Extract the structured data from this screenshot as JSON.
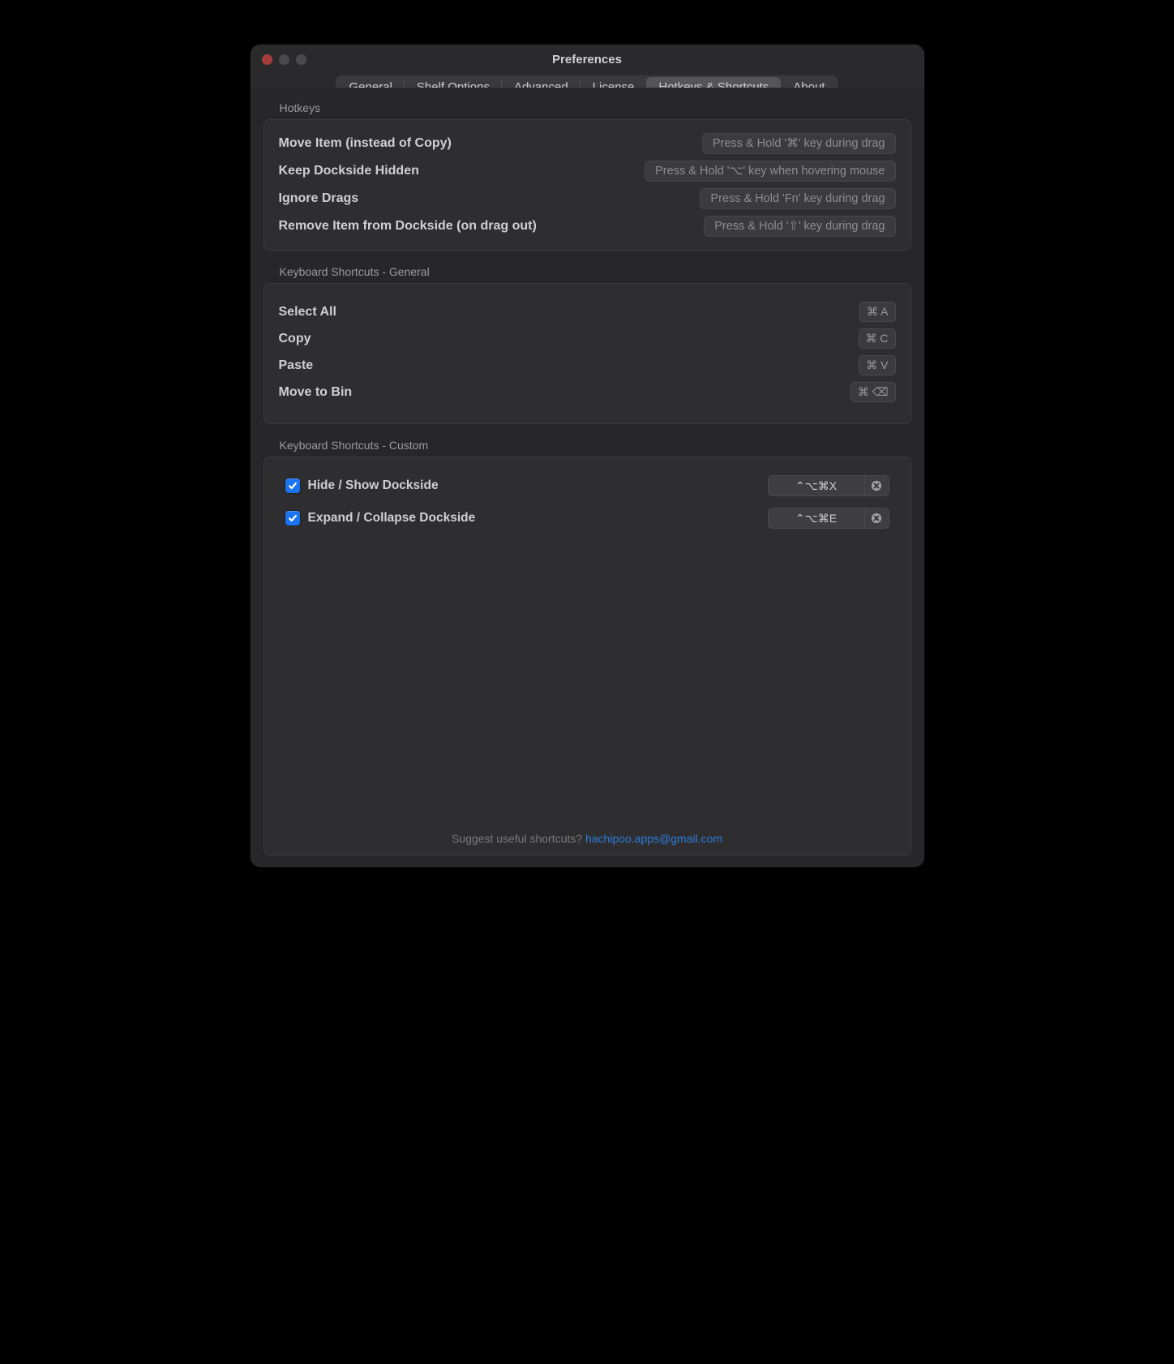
{
  "window": {
    "title": "Preferences"
  },
  "tabs": [
    {
      "label": "General",
      "selected": false
    },
    {
      "label": "Shelf Options",
      "selected": false
    },
    {
      "label": "Advanced",
      "selected": false
    },
    {
      "label": "License",
      "selected": false
    },
    {
      "label": "Hotkeys & Shortcuts",
      "selected": true
    },
    {
      "label": "About",
      "selected": false
    }
  ],
  "sections": {
    "hotkeys": {
      "title": "Hotkeys",
      "rows": [
        {
          "label": "Move Item (instead of Copy)",
          "hint": "Press & Hold '⌘' key during drag"
        },
        {
          "label": "Keep Dockside Hidden",
          "hint": "Press & Hold '⌥' key when hovering mouse"
        },
        {
          "label": "Ignore Drags",
          "hint": "Press & Hold 'Fn' key during drag"
        },
        {
          "label": "Remove Item from Dockside (on drag out)",
          "hint": "Press & Hold '⇧' key during drag"
        }
      ]
    },
    "general": {
      "title": "Keyboard Shortcuts - General",
      "rows": [
        {
          "label": "Select All",
          "shortcut": "⌘ A"
        },
        {
          "label": "Copy",
          "shortcut": "⌘ C"
        },
        {
          "label": "Paste",
          "shortcut": "⌘ V"
        },
        {
          "label": "Move to Bin",
          "shortcut": "⌘ ⌫"
        }
      ]
    },
    "custom": {
      "title": "Keyboard Shortcuts - Custom",
      "rows": [
        {
          "checked": true,
          "label": "Hide / Show Dockside",
          "shortcut": "⌃⌥⌘X"
        },
        {
          "checked": true,
          "label": "Expand / Collapse Dockside",
          "shortcut": "⌃⌥⌘E"
        }
      ]
    }
  },
  "footer": {
    "prompt": "Suggest useful shortcuts? ",
    "link_text": "hachipoo.apps@gmail.com"
  }
}
